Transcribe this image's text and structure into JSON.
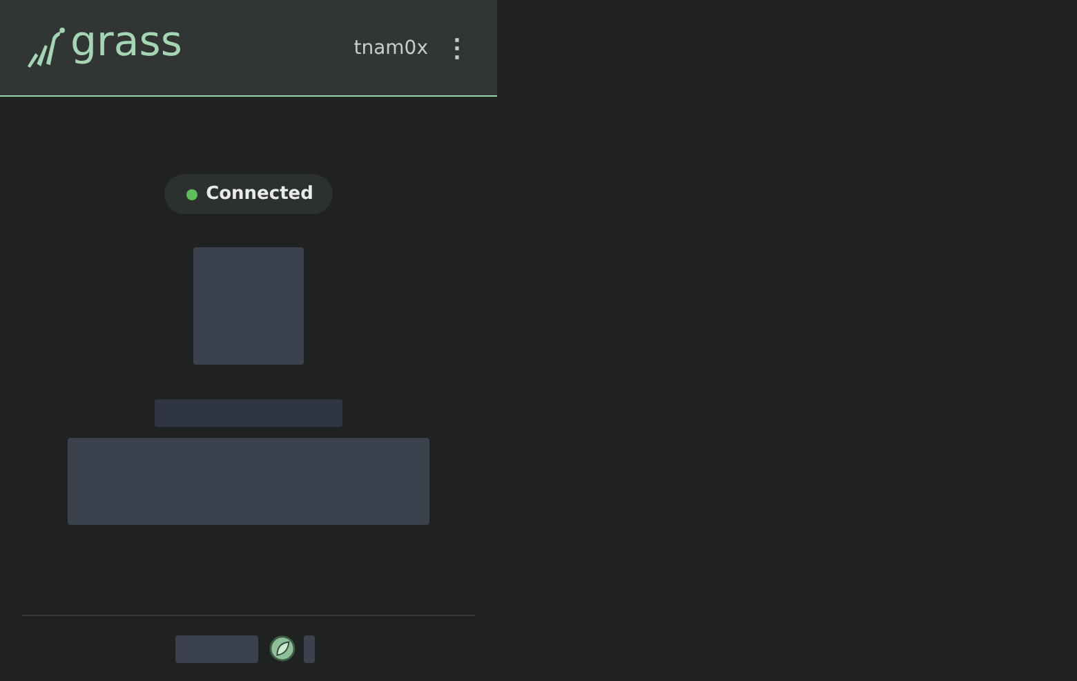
{
  "header": {
    "logo_text": "grass",
    "username": "tnam0x",
    "menu_icon": "⋮"
  },
  "status": {
    "label": "Connected",
    "connected": true,
    "color": "#5cbf5a"
  }
}
